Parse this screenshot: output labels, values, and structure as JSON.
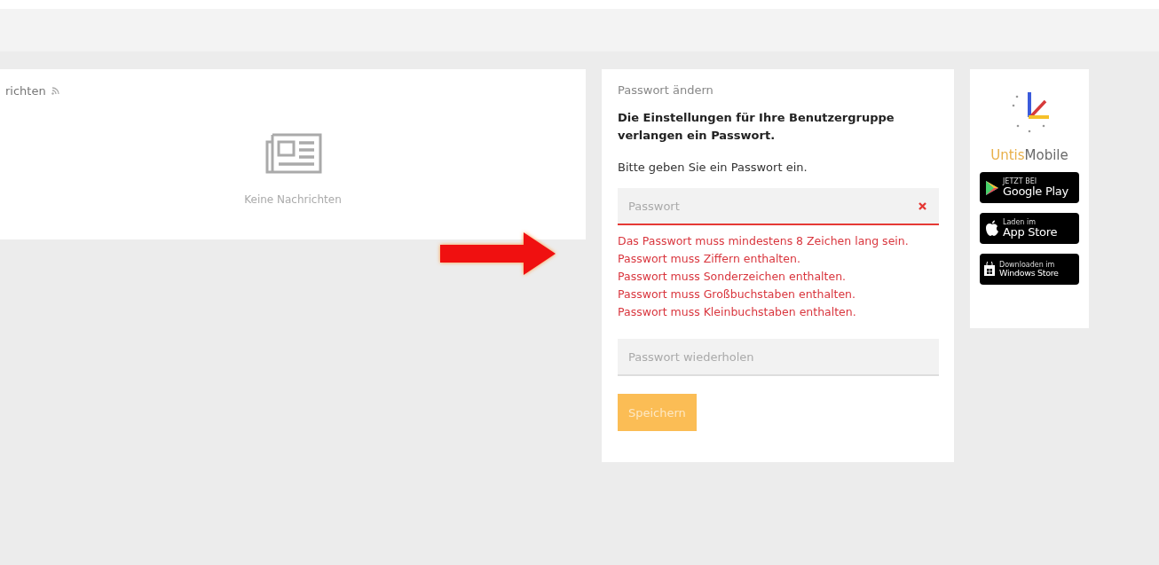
{
  "news": {
    "title": "richten",
    "empty_text": "Keine Nachrichten"
  },
  "password": {
    "title": "Passwort ändern",
    "notice": "Die Einstellungen für Ihre Benutzergruppe verlangen ein Passwort.",
    "prompt": "Bitte geben Sie ein Passwort ein.",
    "fields": [
      {
        "placeholder": "Passwort",
        "error": true
      },
      {
        "placeholder": "Passwort wiederholen",
        "error": false
      }
    ],
    "errors": [
      "Das Passwort muss mindestens 8 Zeichen lang sein.",
      "Passwort muss Ziffern enthalten.",
      "Passwort muss Sonderzeichen enthalten.",
      "Passwort muss Großbuchstaben enthalten.",
      "Passwort muss Kleinbuchstaben enthalten."
    ],
    "save_button": {
      "label": "Speichern",
      "disabled": true
    }
  },
  "app_promo": {
    "brand_first": "Untis",
    "brand_second": "Mobile",
    "stores": [
      {
        "kind": "google",
        "small": "JETZT BEI",
        "big": "Google Play"
      },
      {
        "kind": "apple",
        "small": "Laden im",
        "big": "App Store"
      },
      {
        "kind": "windows",
        "small": "Downloaden im",
        "big": "Windows Store"
      }
    ]
  }
}
